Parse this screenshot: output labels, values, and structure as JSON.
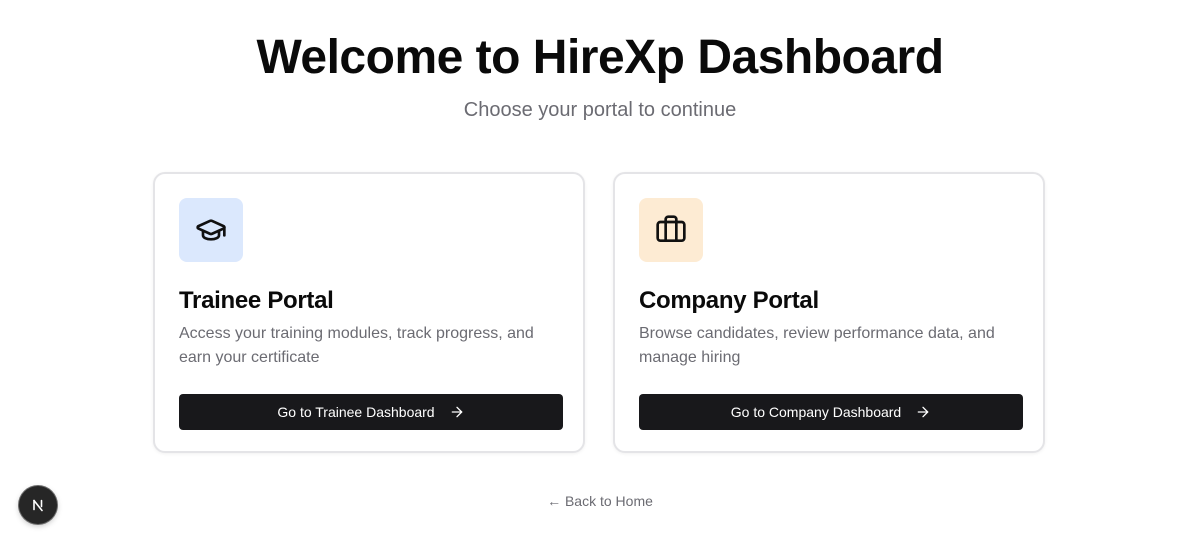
{
  "header": {
    "title": "Welcome to HireXp Dashboard",
    "subtitle": "Choose your portal to continue"
  },
  "portals": [
    {
      "icon": "graduation-cap-icon",
      "icon_bg": "#dbe8fd",
      "title": "Trainee Portal",
      "description": "Access your training modules, track progress, and earn your certificate",
      "button_label": "Go to Trainee Dashboard"
    },
    {
      "icon": "briefcase-icon",
      "icon_bg": "#fdebd3",
      "title": "Company Portal",
      "description": "Browse candidates, review performance data, and manage hiring",
      "button_label": "Go to Company Dashboard"
    }
  ],
  "footer": {
    "back_label": "← Back to Home"
  },
  "colors": {
    "button_bg": "#18181b",
    "muted_text": "#6b6b72"
  }
}
